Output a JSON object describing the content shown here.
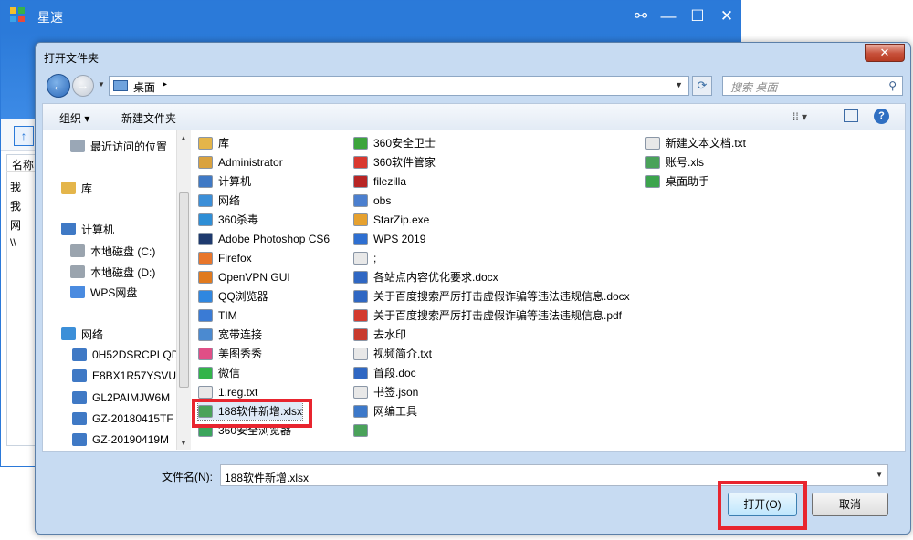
{
  "bg_app": {
    "title": "星速",
    "list_header": "名称",
    "rows": [
      "我",
      "我",
      "网",
      "\\\\"
    ]
  },
  "dialog": {
    "title": "打开文件夹",
    "close": "✕"
  },
  "nav": {
    "address": "桌面",
    "search_placeholder": "搜索 桌面"
  },
  "toolbar": {
    "organize": "组织 ▾",
    "new_folder": "新建文件夹",
    "views": "⁞⁞ ▾",
    "help": "?"
  },
  "navpane": [
    {
      "label": "最近访问的位置",
      "icon": "recent-icon",
      "color": "#9aa7b6"
    },
    {
      "label": "库",
      "icon": "library-icon",
      "color": "#e4b54a"
    },
    {
      "label": "计算机",
      "icon": "computer-icon",
      "color": "#3f79c5"
    },
    {
      "label": "本地磁盘 (C:)",
      "icon": "drive-icon",
      "color": "#9aa4ae"
    },
    {
      "label": "本地磁盘 (D:)",
      "icon": "drive-icon",
      "color": "#9aa4ae"
    },
    {
      "label": "WPS网盘",
      "icon": "cloud-icon",
      "color": "#4a8be0"
    },
    {
      "label": "网络",
      "icon": "network-icon",
      "color": "#3c8fd8"
    },
    {
      "label": "0H52DSRCPLQD",
      "icon": "pc-icon",
      "color": "#3f79c5"
    },
    {
      "label": "E8BX1R57YSVU",
      "icon": "pc-icon",
      "color": "#3f79c5"
    },
    {
      "label": "GL2PAIMJW6M",
      "icon": "pc-icon",
      "color": "#3f79c5"
    },
    {
      "label": "GZ-20180415TF",
      "icon": "pc-icon",
      "color": "#3f79c5"
    },
    {
      "label": "GZ-20190419M",
      "icon": "pc-icon",
      "color": "#3f79c5"
    }
  ],
  "files_col1": [
    {
      "label": "库",
      "icon": "folder-icon",
      "color": "#e4b54a"
    },
    {
      "label": "Administrator",
      "icon": "user-folder-icon",
      "color": "#d9a23f"
    },
    {
      "label": "计算机",
      "icon": "computer-icon",
      "color": "#3f79c5"
    },
    {
      "label": "网络",
      "icon": "network-icon",
      "color": "#3c8fd8"
    },
    {
      "label": "360杀毒",
      "icon": "shortcut-icon",
      "color": "#2e8ed6"
    },
    {
      "label": "Adobe Photoshop CS6",
      "icon": "ps-icon",
      "color": "#1e3a6e"
    },
    {
      "label": "Firefox",
      "icon": "firefox-icon",
      "color": "#e8762b"
    },
    {
      "label": "OpenVPN GUI",
      "icon": "vpn-icon",
      "color": "#e07a1f"
    },
    {
      "label": "QQ浏览器",
      "icon": "qqbrowser-icon",
      "color": "#2f87e0"
    },
    {
      "label": "TIM",
      "icon": "tim-icon",
      "color": "#3a7bd5"
    },
    {
      "label": "宽带连接",
      "icon": "broadband-icon",
      "color": "#4b8ad0"
    },
    {
      "label": "美图秀秀",
      "icon": "meitu-icon",
      "color": "#e04f86"
    },
    {
      "label": "微信",
      "icon": "wechat-icon",
      "color": "#33b44a"
    },
    {
      "label": "1.reg.txt",
      "icon": "txt-icon",
      "color": "#e8e8e8"
    },
    {
      "label": "188软件新增.xlsx",
      "icon": "xlsx-icon",
      "color": "#4aa25a"
    },
    {
      "label": "360安全浏览器",
      "icon": "360browser-icon",
      "color": "#3ba55c"
    }
  ],
  "files_col2": [
    {
      "label": "360安全卫士",
      "icon": "360safe-icon",
      "color": "#3ca43c"
    },
    {
      "label": "360软件管家",
      "icon": "360soft-icon",
      "color": "#d9382f"
    },
    {
      "label": "filezilla",
      "icon": "filezilla-icon",
      "color": "#b82525"
    },
    {
      "label": "obs",
      "icon": "obs-icon",
      "color": "#4b7fcf"
    },
    {
      "label": "StarZip.exe",
      "icon": "starzip-icon",
      "color": "#e6a12f"
    },
    {
      "label": "WPS 2019",
      "icon": "wps-icon",
      "color": "#2e6fd1"
    },
    {
      "label": ";",
      "icon": "txt-icon",
      "color": "#e8e8e8"
    },
    {
      "label": "各站点内容优化要求.docx",
      "icon": "docx-icon",
      "color": "#2f67c3"
    },
    {
      "label": "关于百度搜索严厉打击虚假诈骗等违法违规信息.docx",
      "icon": "docx-icon",
      "color": "#2f67c3"
    },
    {
      "label": "关于百度搜索严厉打击虚假诈骗等违法违规信息.pdf",
      "icon": "pdf-icon",
      "color": "#d33a2f"
    },
    {
      "label": "去水印",
      "icon": "watermark-icon",
      "color": "#c83a2e"
    },
    {
      "label": "视频简介.txt",
      "icon": "txt-icon",
      "color": "#e8e8e8"
    },
    {
      "label": "首段.doc",
      "icon": "doc-icon",
      "color": "#2f67c3"
    },
    {
      "label": "书签.json",
      "icon": "json-icon",
      "color": "#e8e8e8"
    },
    {
      "label": "网编工具",
      "icon": "tool-icon",
      "color": "#3c78c9"
    },
    {
      "label": "",
      "icon": "xlsx-icon",
      "color": "#4aa25a"
    }
  ],
  "files_col3": [
    {
      "label": "新建文本文档.txt",
      "icon": "txt-icon",
      "color": "#e8e8e8"
    },
    {
      "label": "账号.xls",
      "icon": "xls-icon",
      "color": "#4aa25a"
    },
    {
      "label": "桌面助手",
      "icon": "desktop-helper-icon",
      "color": "#3ca44d"
    }
  ],
  "footer": {
    "filename_label": "文件名(N):",
    "filename_value": "188软件新增.xlsx",
    "open_button": "打开(O)",
    "cancel_button": "取消"
  }
}
